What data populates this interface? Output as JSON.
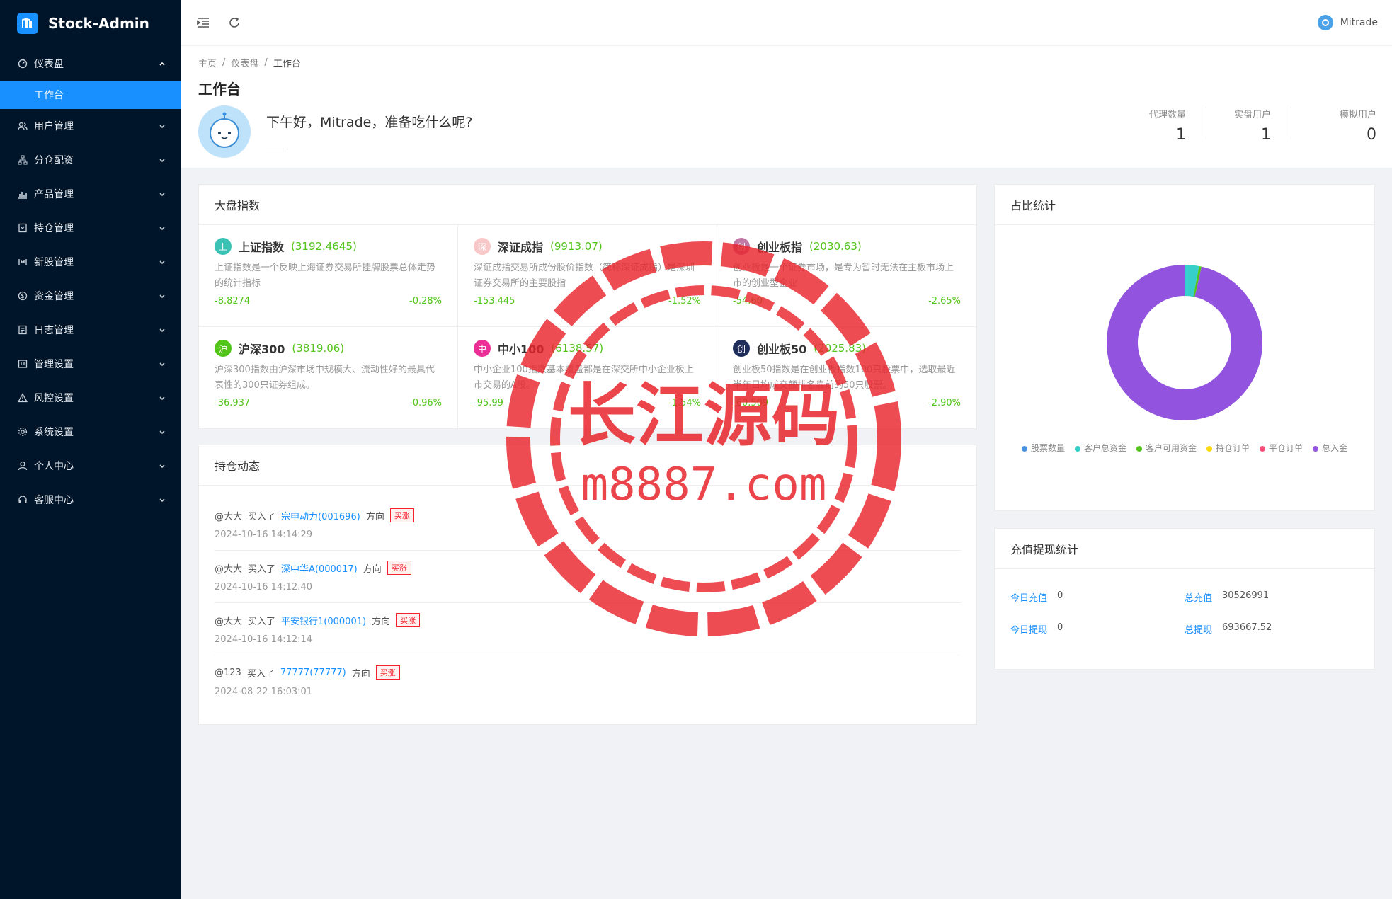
{
  "brand": {
    "name": "Stock-Admin"
  },
  "sidebar": {
    "items": [
      {
        "label": "仪表盘",
        "icon": "dashboard-icon",
        "open": true
      },
      {
        "label": "用户管理",
        "icon": "users-icon"
      },
      {
        "label": "分仓配资",
        "icon": "sitemap-icon"
      },
      {
        "label": "产品管理",
        "icon": "bar-chart-icon"
      },
      {
        "label": "持仓管理",
        "icon": "position-icon"
      },
      {
        "label": "新股管理",
        "icon": "new-stock-icon"
      },
      {
        "label": "资金管理",
        "icon": "coin-icon"
      },
      {
        "label": "日志管理",
        "icon": "log-icon"
      },
      {
        "label": "管理设置",
        "icon": "admin-settings-icon"
      },
      {
        "label": "风控设置",
        "icon": "warning-icon"
      },
      {
        "label": "系统设置",
        "icon": "gear-icon"
      },
      {
        "label": "个人中心",
        "icon": "person-icon"
      },
      {
        "label": "客服中心",
        "icon": "headset-icon"
      }
    ],
    "sub_active": "工作台"
  },
  "header": {
    "user_name": "Mitrade"
  },
  "breadcrumb": [
    "主页",
    "仪表盘",
    "工作台"
  ],
  "page": {
    "title": "工作台",
    "greeting": "下午好，Mitrade，准备吃什么呢?"
  },
  "stats": [
    {
      "label": "代理数量",
      "value": "1"
    },
    {
      "label": "实盘用户",
      "value": "1"
    },
    {
      "label": "模拟用户",
      "value": "0"
    }
  ],
  "market": {
    "title": "大盘指数",
    "indices": [
      {
        "badge": "上",
        "color": "#3cc2b4",
        "name": "上证指数",
        "price": "(3192.4645)",
        "desc": "上证指数是一个反映上海证券交易所挂牌股票总体走势的统计指标",
        "change": "-8.8274",
        "pct": "-0.28%"
      },
      {
        "badge": "深",
        "color": "#f8c8c8",
        "name": "深证成指",
        "price": "(9913.07)",
        "desc": "深证成指交易所成份股价指数（简称深证成指）是深圳证券交易所的主要股指",
        "change": "-153.445",
        "pct": "-1.52%"
      },
      {
        "badge": "创",
        "color": "#c07aa5",
        "name": "创业板指",
        "price": "(2030.63)",
        "desc": "创业板是一个证券市场，是专为暂时无法在主板市场上市的创业型企业",
        "change": "-54.60",
        "pct": "-2.65%"
      },
      {
        "badge": "沪",
        "color": "#52c41a",
        "name": "沪深300",
        "price": "(3819.06)",
        "desc": "沪深300指数由沪深市场中规模大、流动性好的最具代表性的300只证券组成。",
        "change": "-36.937",
        "pct": "-0.96%"
      },
      {
        "badge": "中",
        "color": "#eb2f96",
        "name": "中小100",
        "price": "(6138.57)",
        "desc": "中小企业100指数基本覆盖都是在深交所中小企业板上市交易的A股。",
        "change": "-95.99",
        "pct": "-1.54%"
      },
      {
        "badge": "创",
        "color": "#1f2d5a",
        "name": "创业板50",
        "price": "(2025.83)",
        "desc": "创业板50指数是在创业板指数100只股票中，选取最近半年日均成交额排名靠前的50只股票。",
        "change": "-60.509",
        "pct": "-2.90%"
      }
    ]
  },
  "positions": {
    "title": "持仓动态",
    "items": [
      {
        "user": "@大大",
        "action": "买入了",
        "stock": "宗申动力(001696)",
        "dir_label": "方向",
        "tag": "买涨",
        "time": "2024-10-16 14:14:29"
      },
      {
        "user": "@大大",
        "action": "买入了",
        "stock": "深中华A(000017)",
        "dir_label": "方向",
        "tag": "买涨",
        "time": "2024-10-16 14:12:40"
      },
      {
        "user": "@大大",
        "action": "买入了",
        "stock": "平安银行1(000001)",
        "dir_label": "方向",
        "tag": "买涨",
        "time": "2024-10-16 14:12:14"
      },
      {
        "user": "@123",
        "action": "买入了",
        "stock": "77777(77777)",
        "dir_label": "方向",
        "tag": "买涨",
        "time": "2024-08-22 16:03:01"
      }
    ]
  },
  "ratio": {
    "title": "占比统计",
    "legend": [
      {
        "label": "股票数量",
        "color": "#4a90e2"
      },
      {
        "label": "客户总资金",
        "color": "#36cfc9"
      },
      {
        "label": "客户可用资金",
        "color": "#52c41a"
      },
      {
        "label": "持仓订单",
        "color": "#fadb14"
      },
      {
        "label": "平仓订单",
        "color": "#f5507a"
      },
      {
        "label": "总入金",
        "color": "#9254de"
      }
    ]
  },
  "chart_data": {
    "type": "pie",
    "categories": [
      "股票数量",
      "客户总资金",
      "客户可用资金",
      "持仓订单",
      "平仓订单",
      "总入金"
    ],
    "values": [
      0,
      3,
      0.5,
      0,
      0,
      96.5
    ],
    "colors": [
      "#4a90e2",
      "#36cfc9",
      "#52c41a",
      "#fadb14",
      "#f5507a",
      "#9254de"
    ],
    "donut": true
  },
  "recharge": {
    "title": "充值提现统计",
    "cells": [
      {
        "label": "今日充值",
        "value": "0"
      },
      {
        "label": "总充值",
        "value": "30526991"
      },
      {
        "label": "今日提现",
        "value": "0"
      },
      {
        "label": "总提现",
        "value": "693667.52"
      }
    ]
  },
  "watermark": {
    "line1": "长江源码",
    "line2": "m8887.com",
    "color": "#e8242c"
  }
}
